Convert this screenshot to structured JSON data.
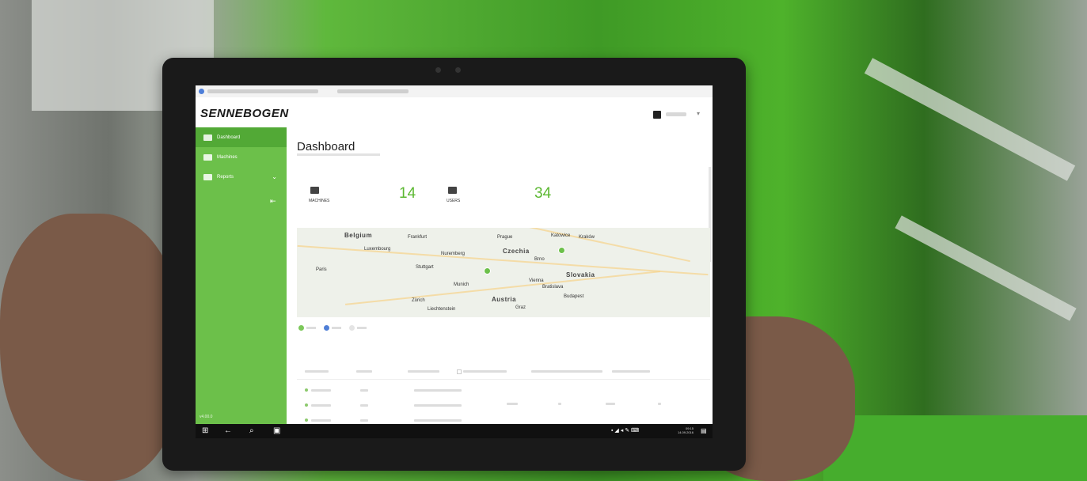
{
  "app": {
    "logo": "SENNEBOGEN"
  },
  "user": {
    "name": ""
  },
  "sidebar": {
    "items": [
      {
        "label": "Dashboard",
        "icon": "dashboard-icon",
        "active": true
      },
      {
        "label": "Machines",
        "icon": "excavator-icon",
        "active": false
      },
      {
        "label": "Reports",
        "icon": "report-icon",
        "active": false
      }
    ],
    "footer": "v4.00.0"
  },
  "main": {
    "title": "Dashboard",
    "stats": [
      {
        "label": "MACHINES",
        "value": "14",
        "icon": "excavator-icon"
      },
      {
        "label": "USERS",
        "value": "34",
        "icon": "user-icon"
      }
    ]
  },
  "map": {
    "labels": [
      "Belgium",
      "Frankfurt",
      "Prague",
      "Katowice",
      "Kraków",
      "Luxembourg",
      "Nuremberg",
      "Czechia",
      "Brno",
      "Stuttgart",
      "Slovakia",
      "Paris",
      "Munich",
      "Vienna",
      "Bratislava",
      "Austria",
      "Budapest",
      "Zürich",
      "Liechtenstein",
      "Graz"
    ]
  },
  "taskbar": {
    "time": "09:15",
    "date": "14.09.2016"
  },
  "colors": {
    "brand_green": "#6cc04a",
    "accent_green": "#5cb832"
  }
}
